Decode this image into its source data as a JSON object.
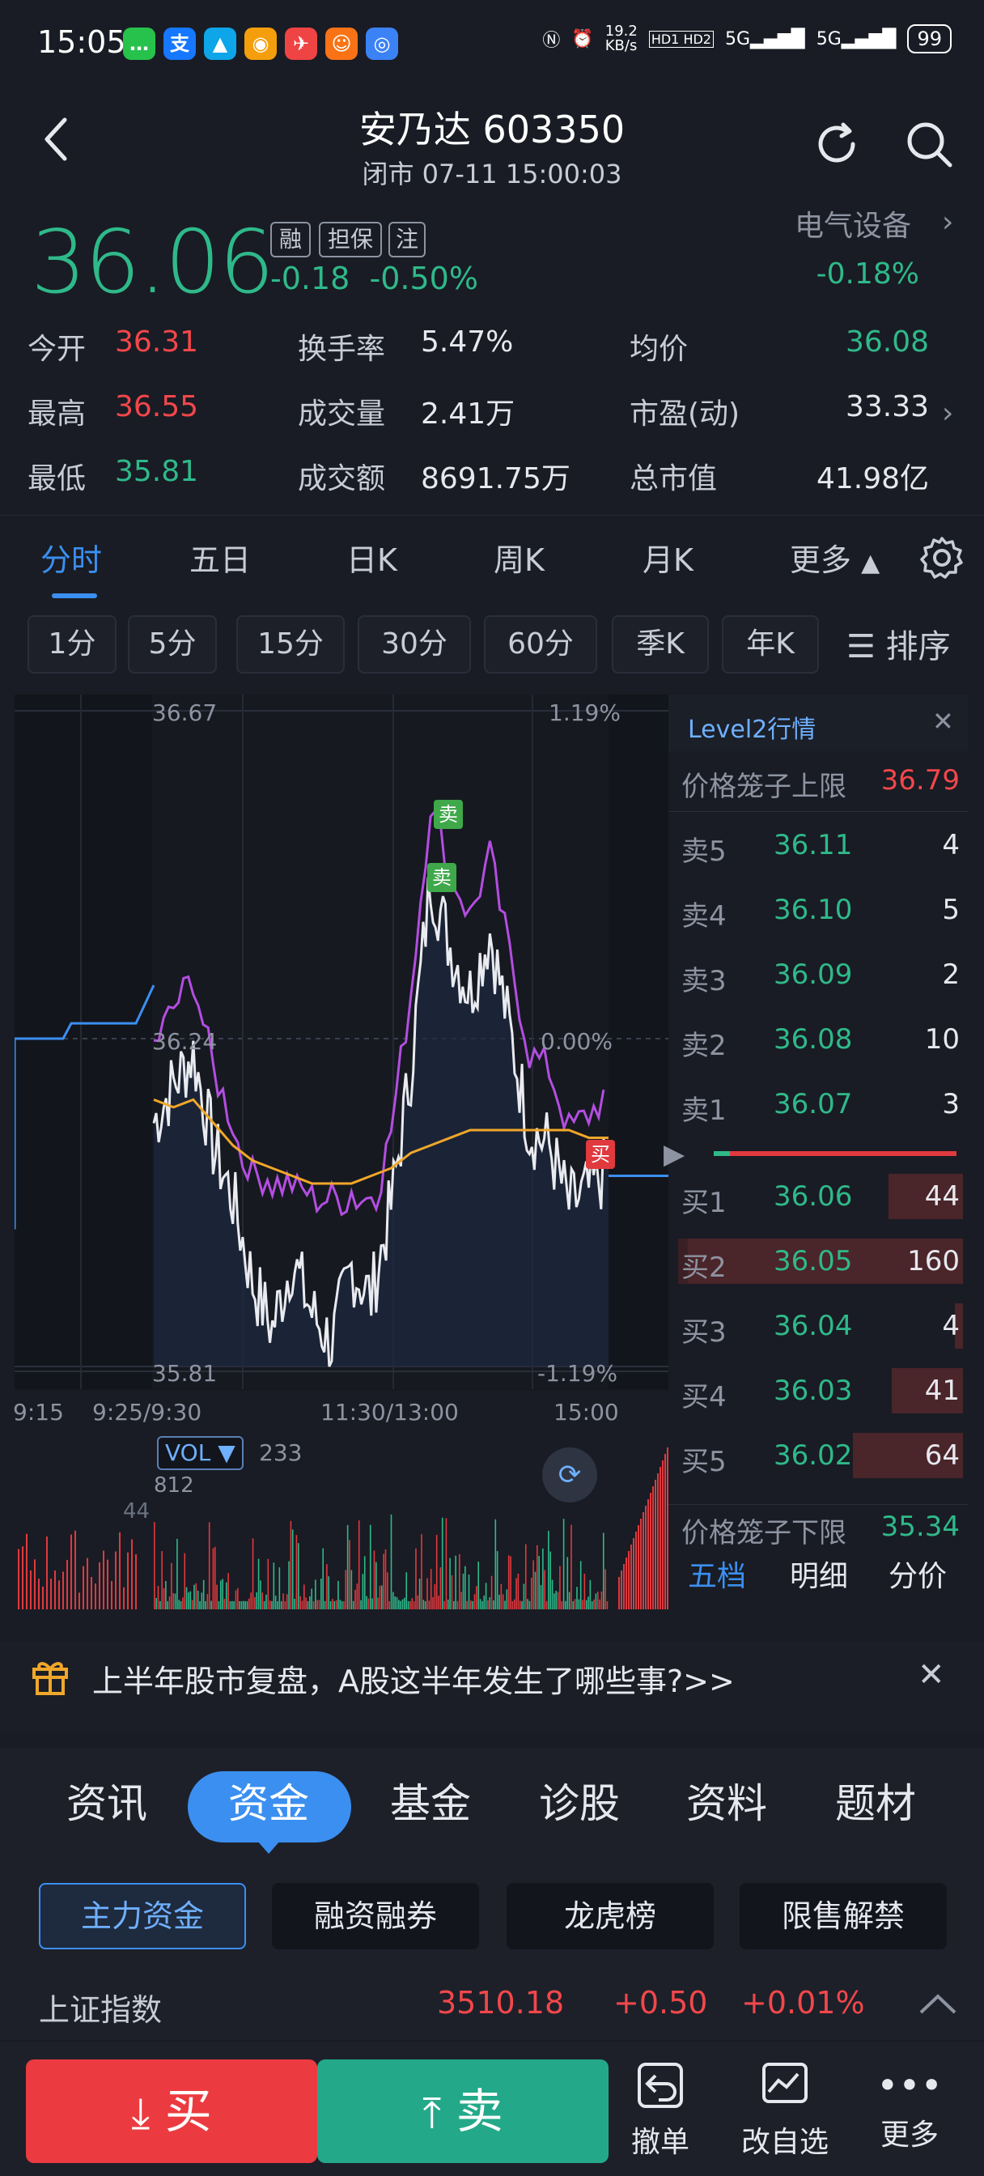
{
  "status_bar": {
    "time": "15:05",
    "net_speed": "19.2\nKB/s",
    "signal_a": "5G",
    "signal_b": "5G",
    "battery": "99",
    "hd": "HD1 HD2"
  },
  "header": {
    "title": "安乃达 603350",
    "status": "闭市 07-11 15:00:03"
  },
  "quote": {
    "price": "36.06",
    "tags": [
      "融",
      "担保",
      "注"
    ],
    "change": "-0.18",
    "change_pct": "-0.50%",
    "sector_name": "电气设备",
    "sector_change": "-0.18%",
    "colors": {
      "down": "#2fb98a",
      "up": "#f2474b"
    }
  },
  "stats": [
    {
      "label": "今开",
      "value": "36.31",
      "tone": "red"
    },
    {
      "label": "换手率",
      "value": "5.47%",
      "tone": "white"
    },
    {
      "label": "均价",
      "value": "36.08",
      "tone": "green"
    },
    {
      "label": "最高",
      "value": "36.55",
      "tone": "red"
    },
    {
      "label": "成交量",
      "value": "2.41万",
      "tone": "white"
    },
    {
      "label": "市盈(动)",
      "value": "33.33",
      "tone": "white"
    },
    {
      "label": "最低",
      "value": "35.81",
      "tone": "green"
    },
    {
      "label": "成交额",
      "value": "8691.75万",
      "tone": "white"
    },
    {
      "label": "总市值",
      "value": "41.98亿",
      "tone": "white"
    }
  ],
  "period_tabs": [
    "分时",
    "五日",
    "日K",
    "周K",
    "月K",
    "更多"
  ],
  "interval_tabs": [
    "1分",
    "5分",
    "15分",
    "30分",
    "60分",
    "季K",
    "年K"
  ],
  "sort_label": "排序",
  "chart": {
    "price_high": "36.67",
    "price_low": "35.81",
    "price_mid": "36.24",
    "pct_high": "1.19%",
    "pct_mid": "0.00%",
    "pct_low": "-1.19%",
    "time_labels": [
      "9:15",
      "9:25/9:30",
      "11:30/13:00",
      "15:00"
    ],
    "sell_marker": "卖",
    "buy_marker": "买",
    "vol_label": "VOL ▼",
    "vol_value": "233",
    "vol_max": "812",
    "vol_mark": "44"
  },
  "chart_data": {
    "type": "line",
    "title": "",
    "series": [
      {
        "values": [
          36.13,
          36.18,
          36.22,
          36.1,
          36.03,
          35.92,
          35.86,
          35.95,
          35.88,
          35.84,
          35.94,
          35.9,
          36.02,
          36.2,
          36.45,
          36.36,
          36.3,
          36.38,
          36.25,
          36.12,
          36.1,
          36.02,
          36.04,
          36.07
        ]
      },
      {
        "values": [
          36.16,
          36.15,
          36.16,
          36.13,
          36.1,
          36.08,
          36.07,
          36.06,
          36.05,
          36.05,
          36.05,
          36.06,
          36.07,
          36.09,
          36.1,
          36.11,
          36.12,
          36.12,
          36.12,
          36.12,
          36.12,
          36.12,
          36.11,
          36.11
        ]
      }
    ],
    "ylim": [
      35.81,
      36.67
    ]
  },
  "level2": {
    "title": "Level2行情",
    "upper_limit_label": "价格笼子上限",
    "upper_limit": "36.79",
    "lower_limit_label": "价格笼子下限",
    "lower_limit": "35.34",
    "asks": [
      {
        "label": "卖5",
        "price": "36.11",
        "vol": "4"
      },
      {
        "label": "卖4",
        "price": "36.10",
        "vol": "5"
      },
      {
        "label": "卖3",
        "price": "36.09",
        "vol": "2"
      },
      {
        "label": "卖2",
        "price": "36.08",
        "vol": "10"
      },
      {
        "label": "卖1",
        "price": "36.07",
        "vol": "3"
      }
    ],
    "bids": [
      {
        "label": "买1",
        "price": "36.06",
        "vol": "44",
        "fill": 0.27
      },
      {
        "label": "买2",
        "price": "36.05",
        "vol": "160",
        "fill": 1.0
      },
      {
        "label": "买3",
        "price": "36.04",
        "vol": "4",
        "fill": 0.03
      },
      {
        "label": "买4",
        "price": "36.03",
        "vol": "41",
        "fill": 0.26
      },
      {
        "label": "买5",
        "price": "36.02",
        "vol": "64",
        "fill": 0.4
      }
    ],
    "tabs": [
      "五档",
      "明细",
      "分价"
    ]
  },
  "promo": {
    "text": "上半年股市复盘，A股这半年发生了哪些事?>>"
  },
  "section_tabs": [
    "资讯",
    "资金",
    "基金",
    "诊股",
    "资料",
    "题材"
  ],
  "sub_tabs": [
    "主力资金",
    "融资融券",
    "龙虎榜",
    "限售解禁"
  ],
  "index_row": {
    "name": "上证指数",
    "value": "3510.18",
    "change": "+0.50",
    "change_pct": "+0.01%"
  },
  "bottom_bar": {
    "buy": "买",
    "sell": "卖",
    "items": [
      "撤单",
      "改自选",
      "更多"
    ]
  }
}
